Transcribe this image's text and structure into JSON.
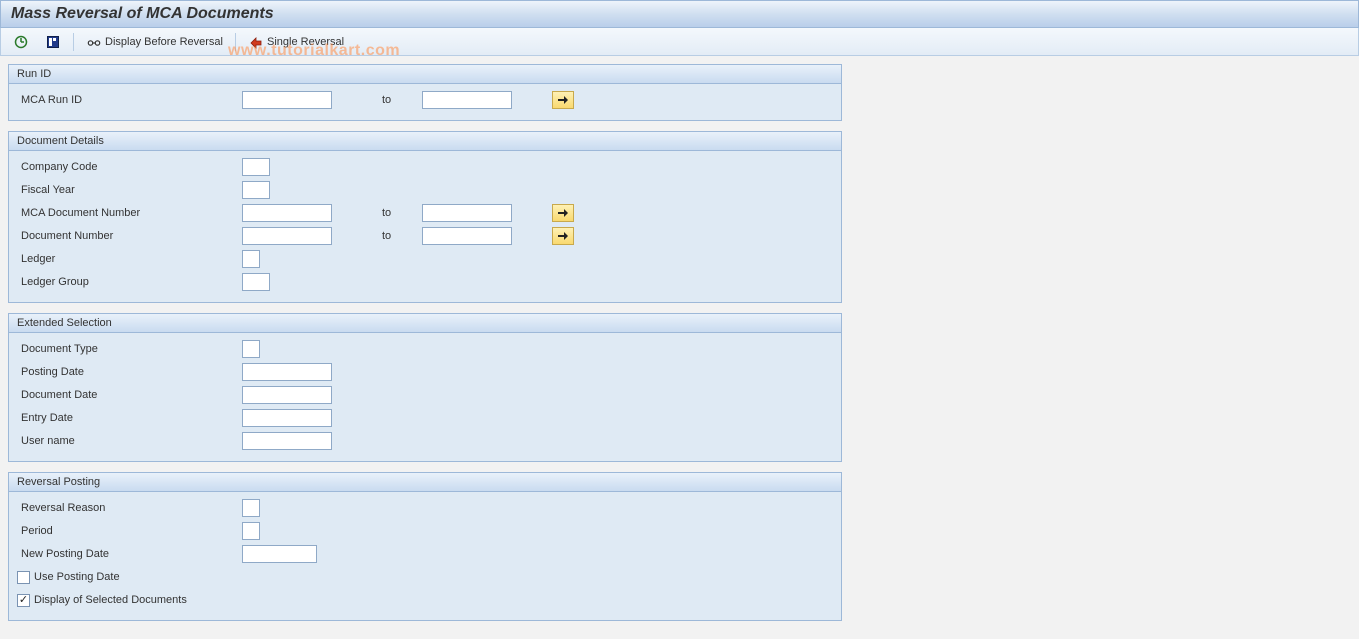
{
  "title": "Mass Reversal of MCA Documents",
  "toolbar": {
    "display_before_reversal": "Display Before Reversal",
    "single_reversal": "Single Reversal"
  },
  "watermark": "www.tutorialkart.com",
  "groups": {
    "run_id": {
      "title": "Run ID",
      "mca_run_id": "MCA Run ID",
      "to": "to"
    },
    "doc_details": {
      "title": "Document Details",
      "company_code": "Company Code",
      "fiscal_year": "Fiscal Year",
      "mca_doc_no": "MCA Document Number",
      "doc_no": "Document Number",
      "ledger": "Ledger",
      "ledger_group": "Ledger Group",
      "to": "to"
    },
    "ext_sel": {
      "title": "Extended Selection",
      "doc_type": "Document Type",
      "posting_date": "Posting Date",
      "doc_date": "Document Date",
      "entry_date": "Entry Date",
      "user_name": "User name"
    },
    "rev_post": {
      "title": "Reversal Posting",
      "rev_reason": "Reversal Reason",
      "period": "Period",
      "new_posting_date": "New Posting Date",
      "use_posting_date": "Use Posting Date",
      "display_selected": "Display of Selected Documents"
    }
  },
  "values": {
    "mca_run_id_from": "",
    "mca_run_id_to": "",
    "company_code": "",
    "fiscal_year": "",
    "mca_doc_no_from": "",
    "mca_doc_no_to": "",
    "doc_no_from": "",
    "doc_no_to": "",
    "ledger": "",
    "ledger_group": "",
    "doc_type": "",
    "posting_date": "",
    "doc_date": "",
    "entry_date": "",
    "user_name": "",
    "rev_reason": "",
    "period": "",
    "new_posting_date": "",
    "use_posting_date_checked": false,
    "display_selected_checked": true
  }
}
